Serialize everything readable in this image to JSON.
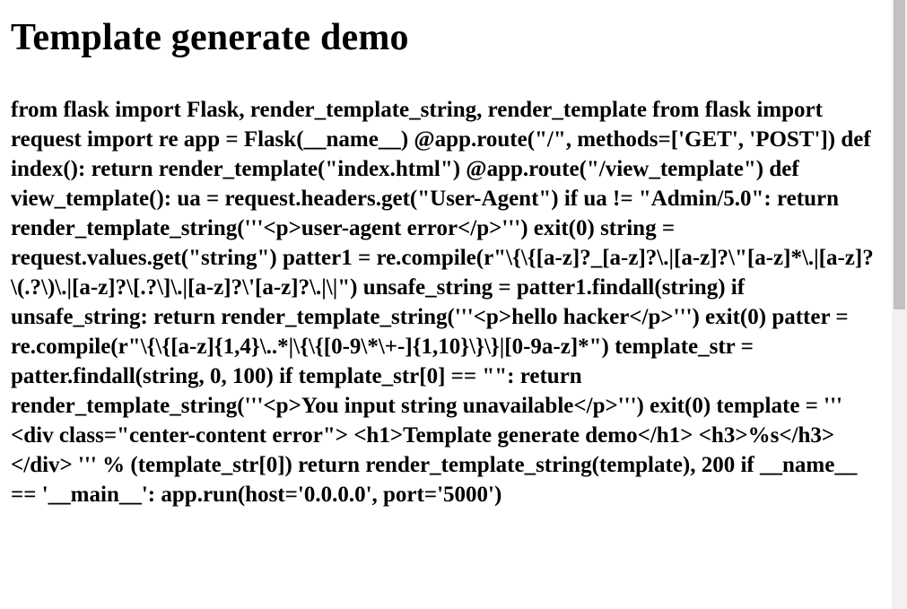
{
  "page": {
    "heading": "Template generate demo",
    "body_text": "from flask import Flask, render_template_string, render_template from flask import request import re app = Flask(__name__) @app.route(\"/\", methods=['GET', 'POST']) def index(): return render_template(\"index.html\") @app.route(\"/view_template\") def view_template(): ua = request.headers.get(\"User-Agent\") if ua != \"Admin/5.0\": return render_template_string('''<p>user-agent error</p>''') exit(0) string = request.values.get(\"string\") patter1 = re.compile(r\"\\{\\{[a-z]?_[a-z]?\\.|[a-z]?\\\"[a-z]*\\.|[a-z]?\\(.?\\)\\.|[a-z]?\\[.?\\]\\.|[a-z]?\\'[a-z]?\\.|\\|\") unsafe_string = patter1.findall(string) if unsafe_string: return render_template_string('''<p>hello hacker</p>''') exit(0) patter = re.compile(r\"\\{\\{[a-z]{1,4}\\..*|\\{\\{[0-9\\*\\+-]{1,10}\\}\\}|[0-9a-z]*\") template_str = patter.findall(string, 0, 100) if template_str[0] == \"\": return render_template_string('''<p>You input string unavailable</p>''') exit(0) template = ''' <div class=\"center-content error\"> <h1>Template generate demo</h1> <h3>%s</h3> </div> ''' % (template_str[0]) return render_template_string(template), 200 if __name__ == '__main__': app.run(host='0.0.0.0', port='5000')"
  },
  "colors": {
    "background": "#ffffff",
    "text": "#000000",
    "scrollbar_track": "#f1f1f1",
    "scrollbar_thumb": "#c1c1c1"
  }
}
